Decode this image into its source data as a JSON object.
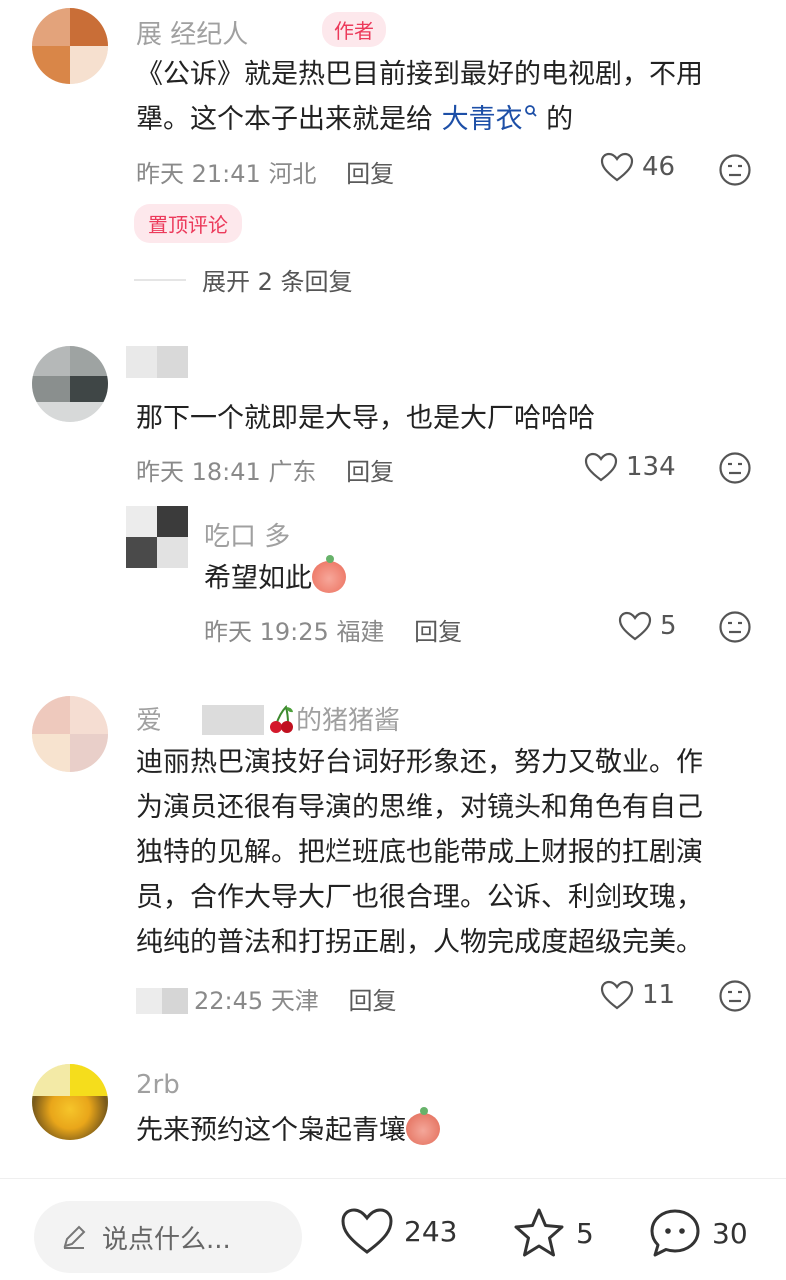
{
  "comments": [
    {
      "username": "展 经纪人",
      "author_tag": "作者",
      "text_line1": "《公诉》就是热巴目前接到最好的电视剧，不用",
      "text_line2_prefix": "犟。这个本子出来就是给 ",
      "text_link": "大青衣",
      "text_line2_suffix": " 的",
      "time": "昨天 21:41",
      "location": "河北",
      "reply_label": "回复",
      "likes": "46",
      "pinned_tag": "置顶评论",
      "expand_label": "展开 2 条回复"
    },
    {
      "username": "",
      "text": "那下一个就即是大导，也是大厂哈哈哈",
      "time": "昨天 18:41",
      "location": "广东",
      "reply_label": "回复",
      "likes": "134",
      "reply": {
        "username": "吃口    多",
        "text": "希望如此",
        "time": "昨天 19:25",
        "location": "福建",
        "reply_label": "回复",
        "likes": "5"
      }
    },
    {
      "username_prefix": "爱",
      "username_suffix": "的猪猪酱",
      "lines": [
        "迪丽热巴演技好台词好形象还，努力又敬业。作",
        "为演员还很有导演的思维，对镜头和角色有自己",
        "独特的见解。把烂班底也能带成上财报的扛剧演",
        "员，合作大导大厂也很合理。公诉、利剑玫瑰，",
        "纯纯的普法和打拐正剧，人物完成度超级完美。"
      ],
      "time": "22:45",
      "location": "天津",
      "reply_label": "回复",
      "likes": "11"
    },
    {
      "username": "2rb",
      "text": "先来预约这个枭起青壤"
    }
  ],
  "bottom_bar": {
    "input_placeholder": "说点什么...",
    "likes": "243",
    "stars": "5",
    "comments": "30"
  }
}
